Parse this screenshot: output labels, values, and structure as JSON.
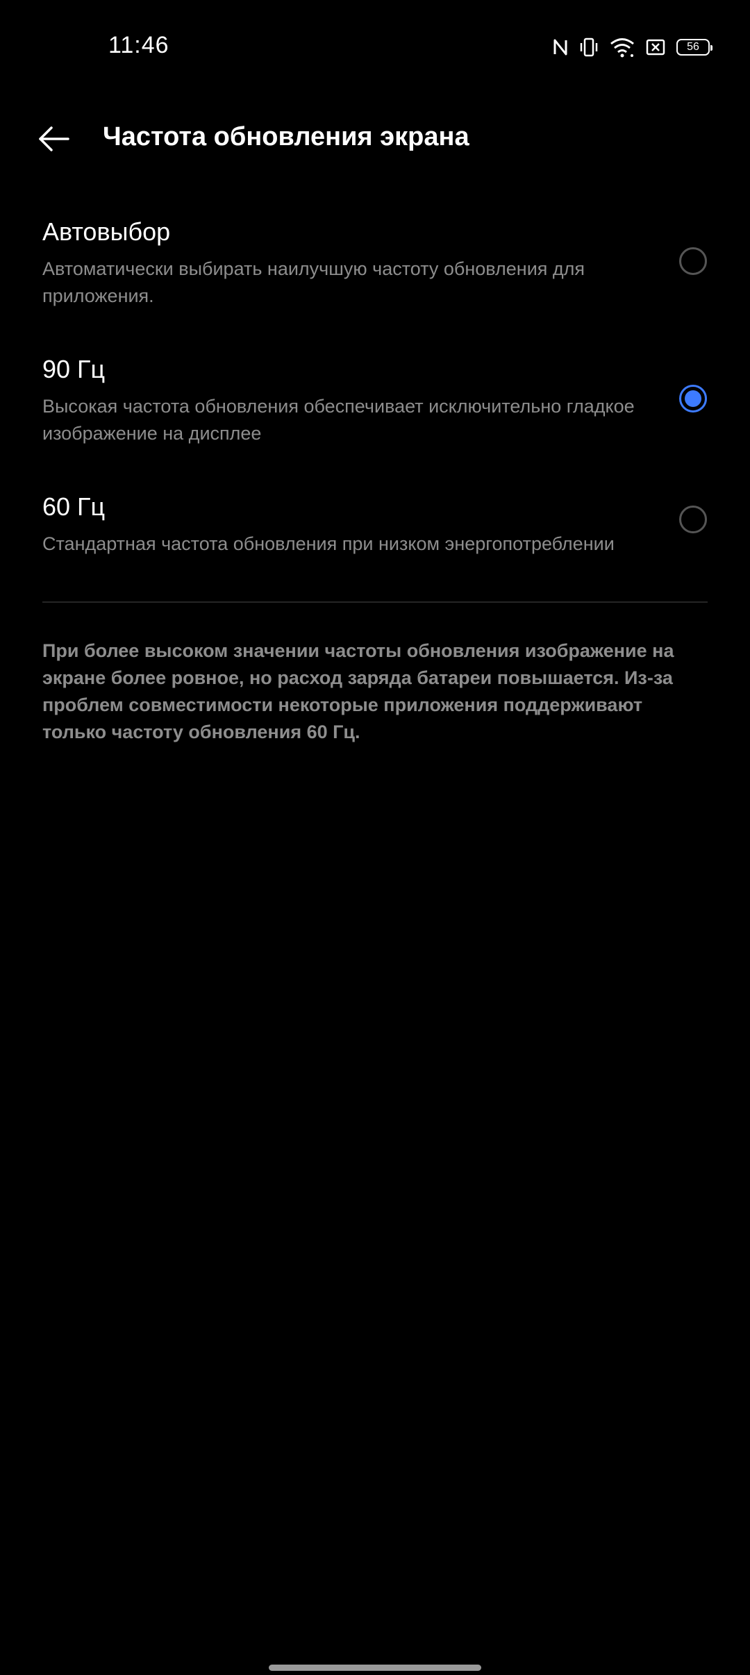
{
  "status_bar": {
    "time": "11:46",
    "battery_level": "56",
    "icons": [
      "nfc-icon",
      "vibrate-icon",
      "wifi-icon",
      "sim-off-icon",
      "battery-icon"
    ]
  },
  "header": {
    "title": "Частота обновления экрана",
    "back_icon": "arrow-left-icon"
  },
  "options": [
    {
      "title": "Автовыбор",
      "description": "Автоматически выбирать наилучшую частоту обновления для приложения.",
      "selected": false
    },
    {
      "title": "90 Гц",
      "description": "Высокая частота обновления обеспечивает исключительно гладкое изображение на дисплее",
      "selected": true
    },
    {
      "title": "60 Гц",
      "description": "Стандартная частота обновления при низком энергопотреблении",
      "selected": false
    }
  ],
  "footnote": "При более высоком значении частоты обновления изображение на экране более ровное, но расход заряда батареи повышается. Из-за проблем совместимости некоторые приложения поддерживают только частоту обновления 60 Гц.",
  "colors": {
    "background": "#000000",
    "accent": "#3d7bff",
    "secondary_text": "#8d8d8d"
  }
}
